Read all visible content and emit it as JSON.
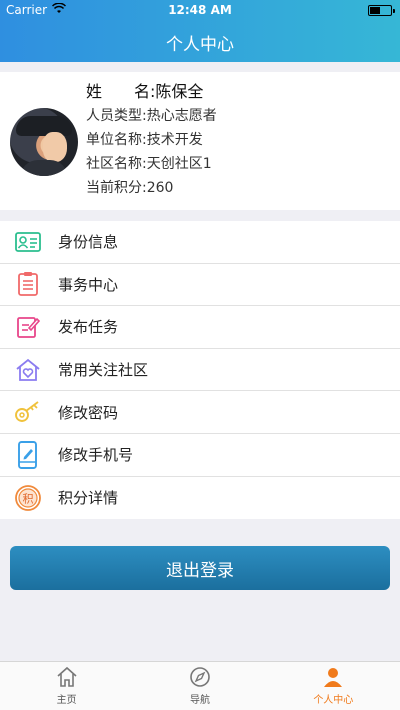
{
  "status_bar": {
    "carrier": "Carrier",
    "time": "12:48 AM"
  },
  "header": {
    "title": "个人中心"
  },
  "profile": {
    "name_label": "姓　　名:",
    "name_value": "陈保全",
    "type_label": "人员类型:",
    "type_value": "热心志愿者",
    "unit_label": "单位名称:",
    "unit_value": "技术开发",
    "community_label": "社区名称:",
    "community_value": "天创社区1",
    "points_label": "当前积分:",
    "points_value": "260"
  },
  "menu": [
    {
      "label": "身份信息",
      "icon": "id-card-icon",
      "color": "#2bbf8f"
    },
    {
      "label": "事务中心",
      "icon": "clipboard-icon",
      "color": "#f06a6a"
    },
    {
      "label": "发布任务",
      "icon": "edit-note-icon",
      "color": "#e8468a"
    },
    {
      "label": "常用关注社区",
      "icon": "home-heart-icon",
      "color": "#8b7cf0"
    },
    {
      "label": "修改密码",
      "icon": "key-icon",
      "color": "#f0c23c"
    },
    {
      "label": "修改手机号",
      "icon": "phone-edit-icon",
      "color": "#3aa0e8"
    },
    {
      "label": "积分详情",
      "icon": "points-icon",
      "color": "#f08a3c"
    }
  ],
  "logout": {
    "label": "退出登录"
  },
  "tabbar": [
    {
      "label": "主页",
      "icon": "home-icon",
      "active": false
    },
    {
      "label": "导航",
      "icon": "compass-icon",
      "active": false
    },
    {
      "label": "个人中心",
      "icon": "person-icon",
      "active": true
    }
  ],
  "colors": {
    "accent": "#f07a1b",
    "header_start": "#2f8fe0",
    "header_end": "#36b7d6",
    "button": "#1f7bad"
  }
}
